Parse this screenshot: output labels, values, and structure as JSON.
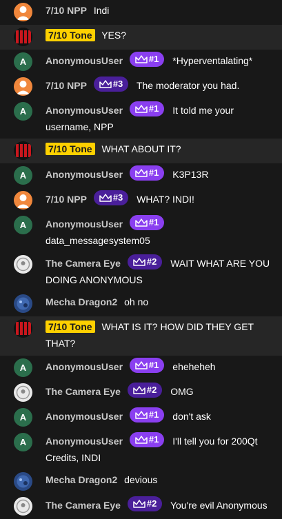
{
  "messages": [
    {
      "user": "7/10 NPP",
      "avatar": "orange",
      "tag": false,
      "badge": "",
      "text": "Indi"
    },
    {
      "user": "7/10 Tone",
      "avatar": "red",
      "tag": true,
      "badge": "",
      "text": "YES?"
    },
    {
      "user": "AnonymousUser",
      "avatar": "green",
      "tag": false,
      "badge": "#1",
      "text": "*Hyperventalating*"
    },
    {
      "user": "7/10 NPP",
      "avatar": "orange",
      "tag": false,
      "badge": "#3",
      "text": "The moderator you had."
    },
    {
      "user": "AnonymousUser",
      "avatar": "green",
      "tag": false,
      "badge": "#1",
      "text": "It told me your username, NPP"
    },
    {
      "user": "7/10 Tone",
      "avatar": "red",
      "tag": true,
      "badge": "",
      "text": "WHAT ABOUT IT?"
    },
    {
      "user": "AnonymousUser",
      "avatar": "green",
      "tag": false,
      "badge": "#1",
      "text": "K3P13R"
    },
    {
      "user": "7/10 NPP",
      "avatar": "orange",
      "tag": false,
      "badge": "#3",
      "text": "WHAT? INDI!"
    },
    {
      "user": "AnonymousUser",
      "avatar": "green",
      "tag": false,
      "badge": "#1",
      "text": "data_messagesystem05"
    },
    {
      "user": "The Camera Eye",
      "avatar": "white",
      "tag": false,
      "badge": "#2",
      "text": "WAIT WHAT ARE YOU DOING ANONYMOUS"
    },
    {
      "user": "Mecha Dragon2",
      "avatar": "blue",
      "tag": false,
      "badge": "",
      "text": "oh no"
    },
    {
      "user": "7/10 Tone",
      "avatar": "red",
      "tag": true,
      "badge": "",
      "text": "WHAT IS IT? HOW DID THEY GET THAT?"
    },
    {
      "user": "AnonymousUser",
      "avatar": "green",
      "tag": false,
      "badge": "#1",
      "text": "eheheheh"
    },
    {
      "user": "The Camera Eye",
      "avatar": "white",
      "tag": false,
      "badge": "#2",
      "text": "OMG"
    },
    {
      "user": "AnonymousUser",
      "avatar": "green",
      "tag": false,
      "badge": "#1",
      "text": "don't ask"
    },
    {
      "user": "AnonymousUser",
      "avatar": "green",
      "tag": false,
      "badge": "#1",
      "text": "I'll tell you for 200Qt Credits, INDI"
    },
    {
      "user": "Mecha Dragon2",
      "avatar": "blue",
      "tag": false,
      "badge": "",
      "text": "devious"
    },
    {
      "user": "The Camera Eye",
      "avatar": "white",
      "tag": false,
      "badge": "#2",
      "text": "You're evil Anonymous"
    }
  ],
  "avatar_letter_green": "A",
  "colors": {
    "highlight_row": "#262626",
    "name_tag": "#fdd000",
    "badge_light": "#8a3ff0",
    "badge_dark": "#4a1f9a",
    "avatar_orange": "#f0873c",
    "avatar_green": "#2b6e4c",
    "avatar_red": "#c8171d",
    "avatar_blue": "#2a4a86"
  }
}
